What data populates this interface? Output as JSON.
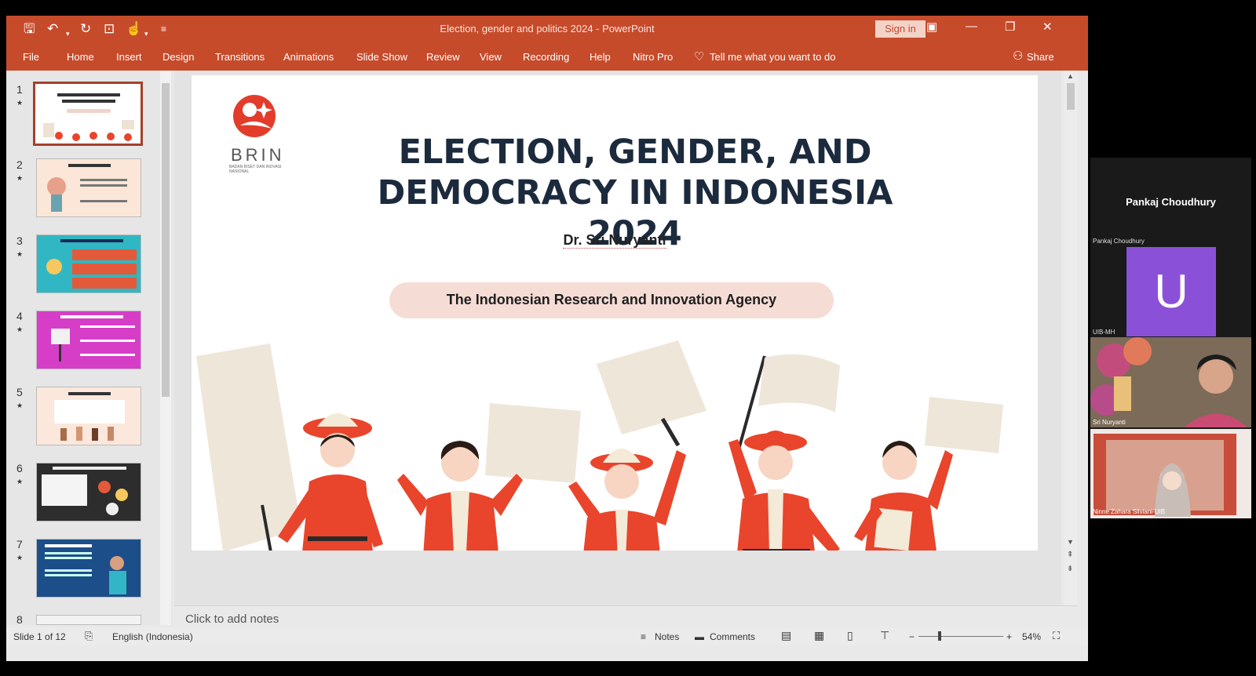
{
  "window": {
    "title": "Election, gender and politics 2024  -  PowerPoint",
    "signin_label": "Sign in"
  },
  "ribbon": {
    "tabs": [
      "File",
      "Home",
      "Insert",
      "Design",
      "Transitions",
      "Animations",
      "Slide Show",
      "Review",
      "View",
      "Recording",
      "Help",
      "Nitro Pro"
    ],
    "tell_me": "Tell me what you want to do",
    "share": "Share"
  },
  "thumbnails": {
    "numbers": [
      "1",
      "2",
      "3",
      "4",
      "5",
      "6",
      "7",
      "8"
    ]
  },
  "slide": {
    "logo_text": "BRIN",
    "logo_subtext": "BADAN RISET DAN INOVASI NASIONAL",
    "title_line1": "ELECTION, GENDER, AND",
    "title_line2": "DEMOCRACY IN INDONESIA 2024",
    "author": "Dr. Sri Nuryanti",
    "agency": "The Indonesian Research and Innovation Agency"
  },
  "notes": {
    "placeholder": "Click to add notes"
  },
  "status": {
    "slide_counter": "Slide 1 of 12",
    "language": "English (Indonesia)",
    "notes": "Notes",
    "comments": "Comments",
    "zoom": "54%"
  },
  "video": {
    "host_name": "Pankaj Choudhury",
    "host_small": "Pankaj Choudhury",
    "avatar_letter": "U",
    "uib_label": "UIB-MH",
    "cam1_label": "Sri Nuryanti",
    "cam2_label": "Ninne Zahara Silviani-UIB"
  },
  "colors": {
    "accent": "#c64b2b",
    "slide_title": "#1c2a3d",
    "figure_red": "#e8452c",
    "sign": "#efe6da",
    "avatar": "#8a51d8"
  }
}
